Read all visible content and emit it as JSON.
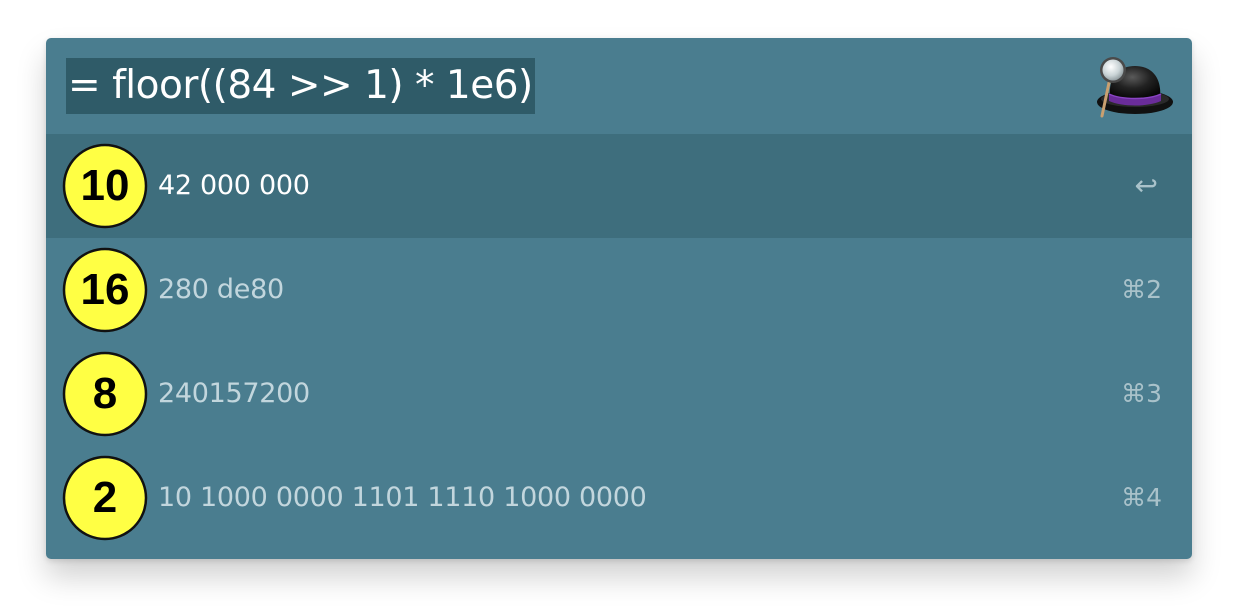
{
  "query": "= floor((84 >> 1) * 1e6)",
  "results": [
    {
      "badge": "10",
      "value": "42 000 000",
      "shortcut": "↩"
    },
    {
      "badge": "16",
      "value": "280 de80",
      "shortcut": "⌘2"
    },
    {
      "badge": "8",
      "value": "240157200",
      "shortcut": "⌘3"
    },
    {
      "badge": "2",
      "value": "10 1000 0000 1101 1110 1000 0000",
      "shortcut": "⌘4"
    }
  ],
  "colors": {
    "window": "#4a7d8f",
    "selected_row": "#3e6e7d",
    "query_highlight": "#2f5b68",
    "badge_fill": "#ffff44"
  },
  "icons": {
    "app": "alfred-hat-icon"
  }
}
